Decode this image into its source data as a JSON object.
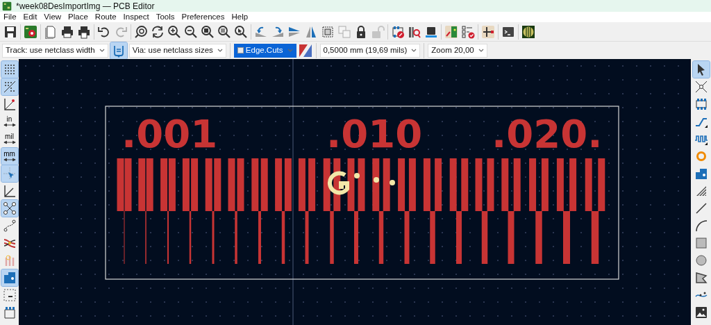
{
  "window": {
    "title": "*week08DesImportImg — PCB Editor"
  },
  "menu": [
    "File",
    "Edit",
    "View",
    "Place",
    "Route",
    "Inspect",
    "Tools",
    "Preferences",
    "Help"
  ],
  "top_toolbar": [
    {
      "kind": "button",
      "disabled": false
    },
    {
      "kind": "separator"
    },
    {
      "kind": "button",
      "disabled": false
    },
    {
      "kind": "separator"
    },
    {
      "kind": "button",
      "disabled": false
    },
    {
      "kind": "button",
      "disabled": false
    },
    {
      "kind": "button",
      "disabled": false
    },
    {
      "kind": "separator"
    },
    {
      "kind": "button",
      "disabled": false
    },
    {
      "kind": "button",
      "disabled": true
    },
    {
      "kind": "separator"
    },
    {
      "kind": "button",
      "disabled": false
    },
    {
      "kind": "button",
      "disabled": false
    },
    {
      "kind": "button",
      "disabled": false
    },
    {
      "kind": "button",
      "disabled": false
    },
    {
      "kind": "button",
      "disabled": false
    },
    {
      "kind": "button",
      "disabled": false
    },
    {
      "kind": "button",
      "disabled": false
    },
    {
      "kind": "separator"
    },
    {
      "kind": "button",
      "disabled": false
    },
    {
      "kind": "button",
      "disabled": false
    },
    {
      "kind": "button",
      "disabled": false
    },
    {
      "kind": "button",
      "disabled": false
    },
    {
      "kind": "button",
      "disabled": false
    },
    {
      "kind": "button",
      "disabled": true
    },
    {
      "kind": "button",
      "disabled": false
    },
    {
      "kind": "button",
      "disabled": true
    },
    {
      "kind": "separator"
    },
    {
      "kind": "button",
      "disabled": false
    },
    {
      "kind": "button",
      "disabled": false
    },
    {
      "kind": "button",
      "disabled": false
    },
    {
      "kind": "separator"
    },
    {
      "kind": "button",
      "disabled": false
    },
    {
      "kind": "button",
      "disabled": false
    },
    {
      "kind": "separator"
    },
    {
      "kind": "button",
      "disabled": false
    },
    {
      "kind": "separator"
    },
    {
      "kind": "button",
      "disabled": false
    },
    {
      "kind": "separator"
    },
    {
      "kind": "button",
      "disabled": false
    }
  ],
  "options_bar": {
    "track_width": "Track: use netclass width",
    "toggle": {
      "selected": true
    },
    "via_size": "Via: use netclass sizes",
    "layer": "Edge.Cuts",
    "grid": "0,5000 mm (19,69 mils)",
    "zoom": "Zoom 20,00"
  },
  "left_toolbar": [
    {
      "selected": true
    },
    {
      "selected": true
    },
    {
      "selected": false
    },
    {
      "selected": false,
      "label": "in"
    },
    {
      "selected": false,
      "label": "mil"
    },
    {
      "selected": true,
      "label": "mm"
    },
    {
      "selected": true
    },
    {
      "selected": false
    },
    {
      "selected": true
    },
    {
      "selected": false
    },
    {
      "selected": false
    },
    {
      "selected": false
    },
    {
      "selected": true
    },
    {
      "selected": false
    },
    {
      "selected": false
    }
  ],
  "right_toolbar": [
    {
      "selected": true
    },
    {
      "selected": false
    },
    {
      "selected": false
    },
    {
      "selected": false
    },
    {
      "selected": false
    },
    {
      "selected": false
    },
    {
      "selected": false
    },
    {
      "selected": false
    },
    {
      "selected": false
    },
    {
      "selected": false
    },
    {
      "selected": false
    },
    {
      "selected": false
    },
    {
      "selected": false
    },
    {
      "selected": false
    },
    {
      "selected": false
    }
  ],
  "canvas": {
    "labels": [
      ".001",
      ".010",
      ".020."
    ]
  }
}
